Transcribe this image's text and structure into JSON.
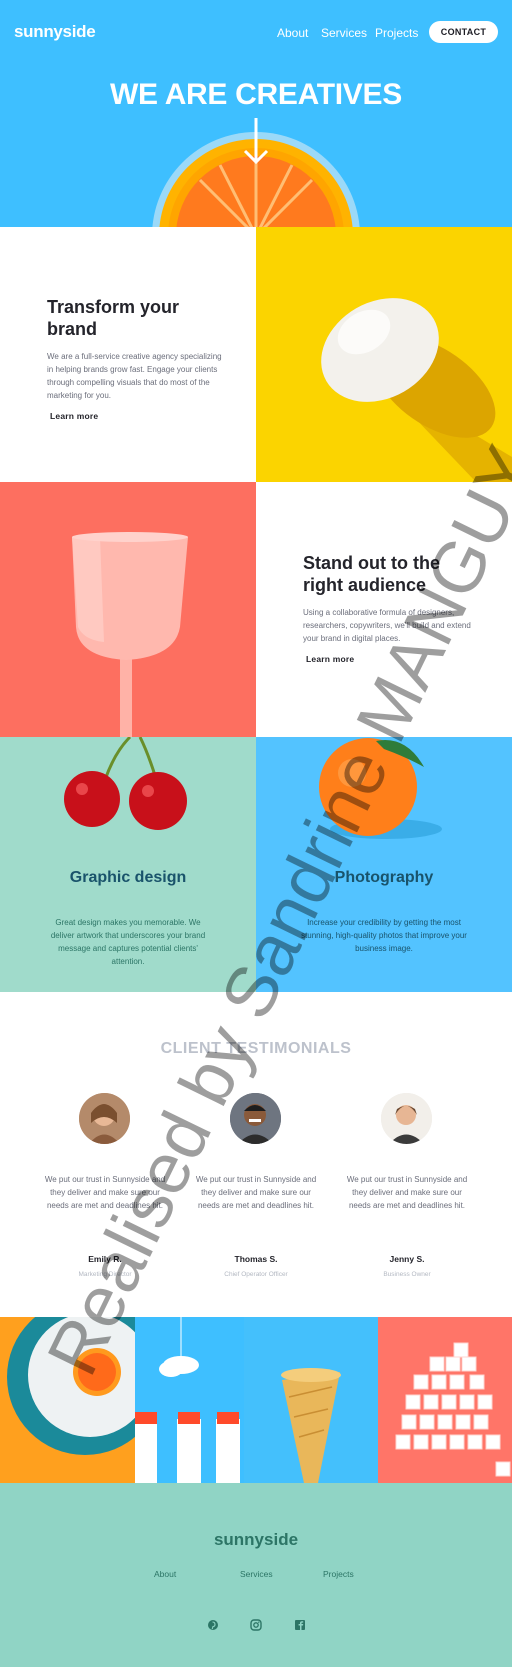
{
  "header": {
    "logo": "sunnyside",
    "nav": [
      "About",
      "Services",
      "Projects"
    ],
    "contact_label": "CONTACT"
  },
  "hero": {
    "title": "WE ARE CREATIVES"
  },
  "features": [
    {
      "title_line1": "Transform your",
      "title_line2": "brand",
      "body": "We are a full-service creative agency specializing in helping brands grow fast. Engage your clients through compelling visuals that do most of the marketing for you.",
      "link": "Learn more"
    },
    {
      "title_line1": "Stand out to the",
      "title_line2": "right audience",
      "body": "Using a collaborative formula of designers, researchers, copywriters, we'll build and extend your brand in digital places.",
      "link": "Learn more"
    }
  ],
  "services": [
    {
      "title": "Graphic design",
      "body": "Great design makes you memorable. We deliver artwork that underscores your brand message and captures potential clients' attention."
    },
    {
      "title": "Photography",
      "body": "Increase your credibility by getting the most stunning, high-quality photos that improve your business image."
    }
  ],
  "testimonials": {
    "heading": "CLIENT TESTIMONIALS",
    "items": [
      {
        "quote": "We put our trust in Sunnyside and they deliver and make sure our needs are met and deadlines hit.",
        "name": "Emily R.",
        "role": "Marketing Director"
      },
      {
        "quote": "We put our trust in Sunnyside and they deliver and make sure our needs are met and deadlines hit.",
        "name": "Thomas S.",
        "role": "Chief Operator Officer"
      },
      {
        "quote": "We put our trust in Sunnyside and they deliver and make sure our needs are met and deadlines hit.",
        "name": "Jenny S.",
        "role": "Business Owner"
      }
    ]
  },
  "footer": {
    "logo": "sunnyside",
    "links": [
      "About",
      "Services",
      "Projects"
    ],
    "social_icons": [
      "pinterest-icon",
      "instagram-icon",
      "facebook-icon"
    ]
  },
  "watermark": "Realised by Sandrine MANGUY",
  "colors": {
    "hero_blue": "#3ebfff",
    "yellow": "#fbd400",
    "coral": "#fe7865",
    "mint": "#a0dbcb",
    "footer_mint": "#90d4c5",
    "dark_green": "#2c7566",
    "dark_blue": "#19536b"
  }
}
